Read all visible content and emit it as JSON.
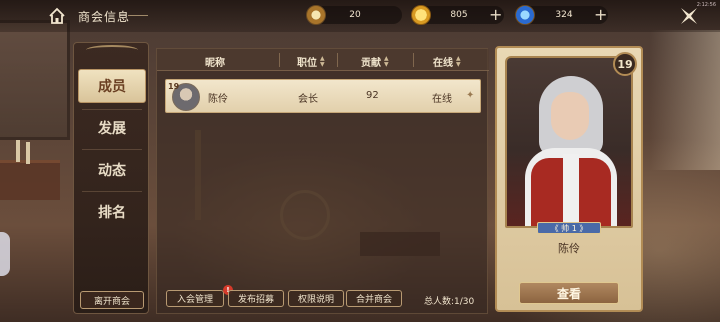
{
  "header": {
    "title": "商会信息",
    "resources": [
      {
        "icon": "crest-token-icon",
        "value": "20"
      },
      {
        "icon": "gold-coin-icon",
        "value": "805"
      },
      {
        "icon": "blue-gem-icon",
        "value": "324"
      }
    ],
    "plus": "+",
    "system": "2:12:56"
  },
  "nav": {
    "items": [
      {
        "label": "成员",
        "active": true
      },
      {
        "label": "发展",
        "active": false
      },
      {
        "label": "动态",
        "active": false
      },
      {
        "label": "排名",
        "active": false
      }
    ],
    "leave_label": "离开商会"
  },
  "table": {
    "columns": [
      "昵称",
      "职位",
      "贡献",
      "在线"
    ],
    "rows": [
      {
        "level": "19",
        "name": "陈伶",
        "position": "会长",
        "contribution": "92",
        "online": "在线"
      }
    ]
  },
  "footer": {
    "buttons": [
      "入会管理",
      "发布招募",
      "权限说明",
      "合并商会"
    ],
    "badge": "!",
    "member_count": "总人数:1/30"
  },
  "card": {
    "level": "19",
    "role": "《 帅 1 》",
    "name": "陈伶",
    "view_label": "查看"
  },
  "colors": {
    "accent": "#b28c55",
    "active_tab_bg": "#f0e2c0",
    "vest": "#a82a22",
    "badge": "#d53a2a"
  }
}
